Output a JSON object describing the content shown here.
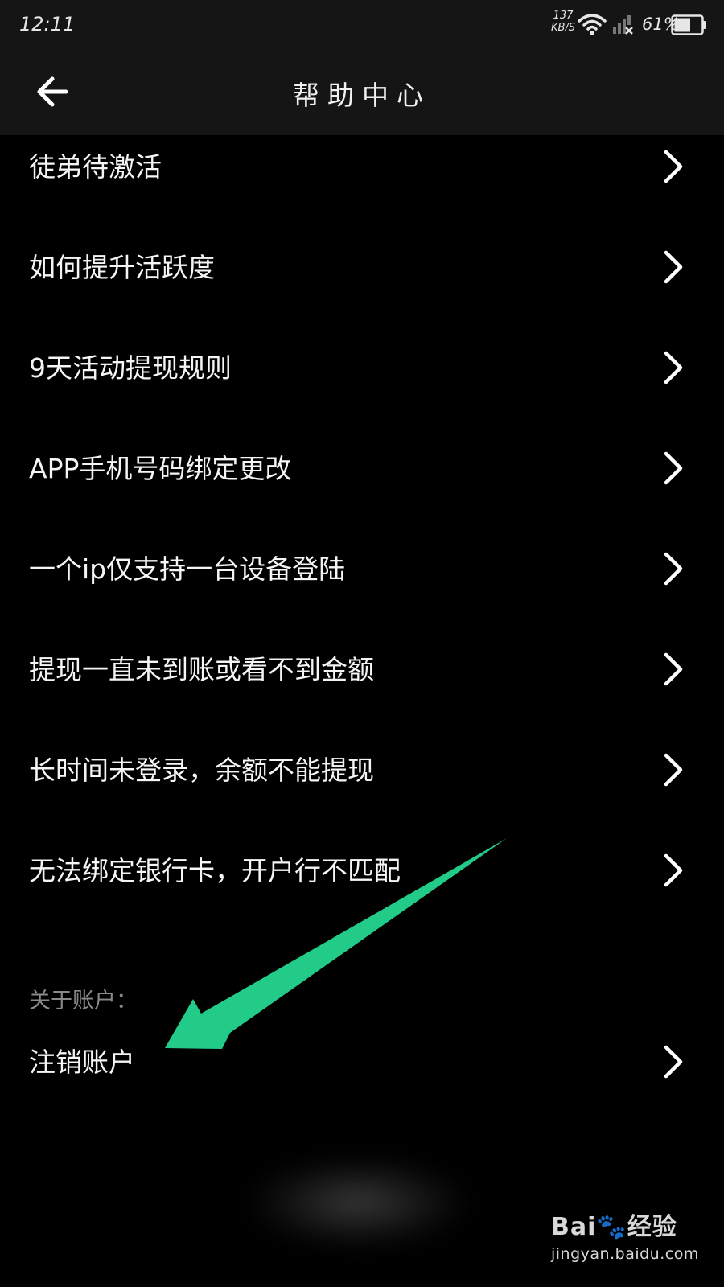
{
  "status_bar": {
    "time": "12:11",
    "net_speed_value": "137",
    "net_speed_unit": "KB/S",
    "battery_percent": "61%",
    "battery_level": 0.61
  },
  "header": {
    "title": "帮助中心"
  },
  "help_items": [
    {
      "label": "徒弟待激活"
    },
    {
      "label": "如何提升活跃度"
    },
    {
      "label": "9天活动提现规则"
    },
    {
      "label": "APP手机号码绑定更改"
    },
    {
      "label": "一个ip仅支持一台设备登陆"
    },
    {
      "label": "提现一直未到账或看不到金额"
    },
    {
      "label": "长时间未登录，余额不能提现"
    },
    {
      "label": "无法绑定银行卡，开户行不匹配"
    }
  ],
  "account_section": {
    "label": "关于账户：",
    "item_label": "注销账户"
  },
  "annotation": {
    "arrow_color": "#22cc88"
  },
  "watermark": {
    "logo_text": "Bai🐾经验",
    "url": "jingyan.baidu.com"
  }
}
